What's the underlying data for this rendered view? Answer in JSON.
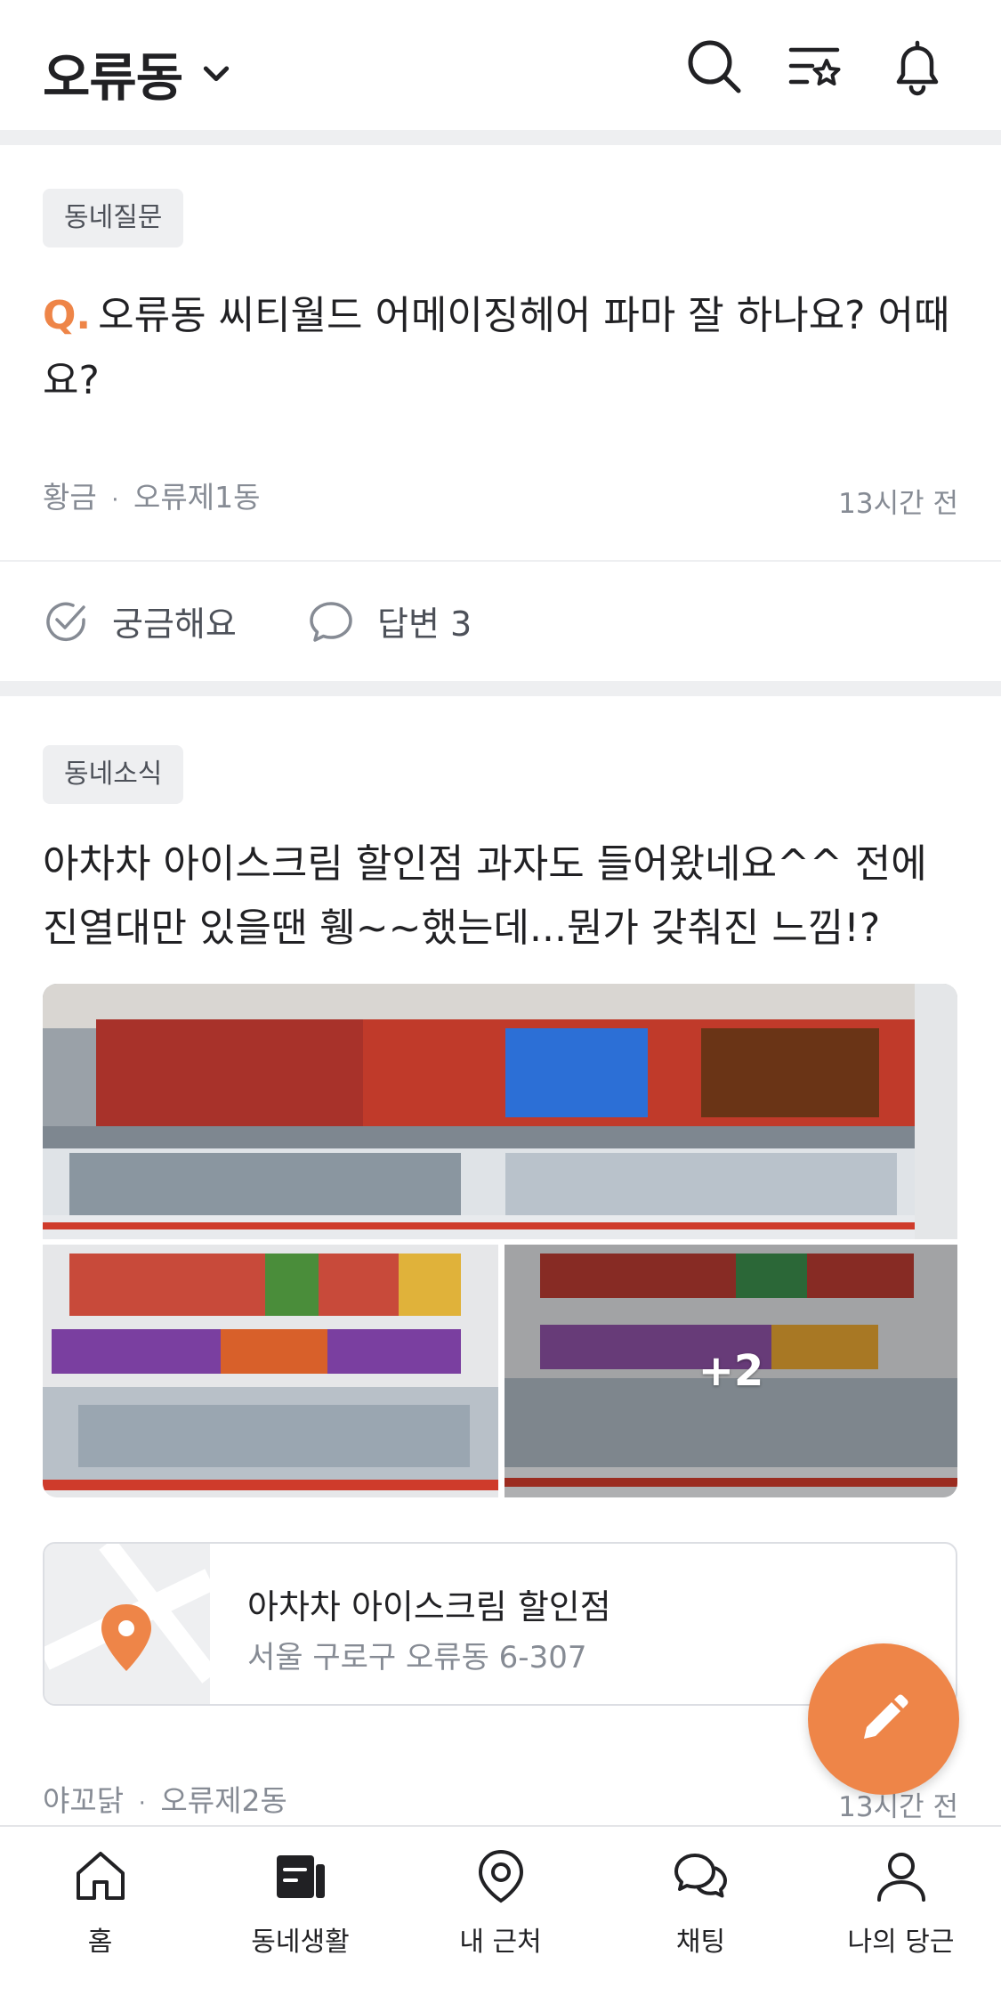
{
  "header": {
    "location": "오류동",
    "icons": [
      "search-icon",
      "category-star-icon",
      "bell-icon"
    ]
  },
  "question_post": {
    "tag": "동네질문",
    "q_mark": "Q.",
    "title": "오류동 씨티월드 어메이징헤어 파마 잘 하나요? 어때요?",
    "author": "황금",
    "dot": "·",
    "region": "오류제1동",
    "time": "13시간 전",
    "actions": {
      "curious_label": "궁금해요",
      "answer_label": "답변 3"
    }
  },
  "news_post": {
    "tag": "동네소식",
    "title": "아차차 아이스크림 할인점 과자도 들어왔네요^^ 전에 진열대만 있을땐 휑~~했는데...뭔가 갖춰진 느낌!?",
    "images_more": "+2",
    "place": {
      "name": "아차차 아이스크림 할인점",
      "address": "서울 구로구 오류동 6-307"
    },
    "author": "야꼬닭",
    "dot": "·",
    "region": "오류제2동",
    "time": "13시간 전"
  },
  "bottom_nav": [
    {
      "label": "홈",
      "icon": "home-icon"
    },
    {
      "label": "동네생활",
      "icon": "neighborhood-icon"
    },
    {
      "label": "내 근처",
      "icon": "location-pin-icon"
    },
    {
      "label": "채팅",
      "icon": "chat-icon"
    },
    {
      "label": "나의 당근",
      "icon": "profile-icon"
    }
  ],
  "colors": {
    "accent": "#ee8548",
    "text": "#212124",
    "subtext": "#868b94",
    "separator": "#eeeff1"
  }
}
